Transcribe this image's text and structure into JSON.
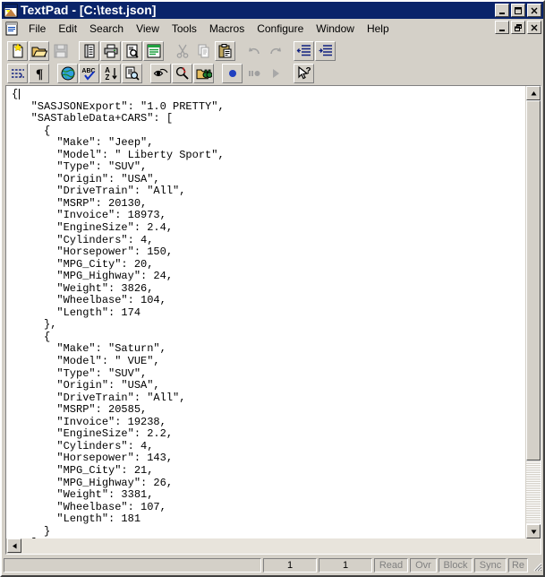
{
  "window": {
    "title": "TextPad - [C:\\test.json]",
    "app_icon": "textpad-icon",
    "controls": [
      {
        "name": "minimize-button",
        "glyph": "minimize-icon"
      },
      {
        "name": "maximize-button",
        "glyph": "maximize-icon"
      },
      {
        "name": "close-button",
        "glyph": "close-icon"
      }
    ],
    "mdi_controls": [
      {
        "name": "mdi-minimize-button",
        "glyph": "minimize-icon"
      },
      {
        "name": "mdi-restore-button",
        "glyph": "restore-icon"
      },
      {
        "name": "mdi-close-button",
        "glyph": "close-icon"
      }
    ]
  },
  "menu": {
    "document_icon": "document-icon",
    "items": [
      {
        "label": "File"
      },
      {
        "label": "Edit"
      },
      {
        "label": "Search"
      },
      {
        "label": "View"
      },
      {
        "label": "Tools"
      },
      {
        "label": "Macros"
      },
      {
        "label": "Configure"
      },
      {
        "label": "Window"
      },
      {
        "label": "Help"
      }
    ]
  },
  "toolbar_row1": [
    {
      "name": "new-file-button",
      "icon": "new-document-icon",
      "enabled": true
    },
    {
      "name": "open-file-button",
      "icon": "open-folder-icon",
      "enabled": true
    },
    {
      "name": "save-file-button",
      "icon": "floppy-disk-icon",
      "enabled": false
    },
    {
      "sep": true
    },
    {
      "name": "document-properties-button",
      "icon": "document-lines-icon",
      "enabled": true
    },
    {
      "name": "print-button",
      "icon": "printer-icon",
      "enabled": true
    },
    {
      "name": "print-preview-button",
      "icon": "magnifier-page-icon",
      "enabled": true
    },
    {
      "name": "document-selector-button",
      "icon": "green-document-icon",
      "enabled": true
    },
    {
      "sep": true
    },
    {
      "name": "cut-button",
      "icon": "scissors-icon",
      "enabled": false
    },
    {
      "name": "copy-button",
      "icon": "copy-pages-icon",
      "enabled": false
    },
    {
      "name": "paste-button",
      "icon": "clipboard-icon",
      "enabled": true
    },
    {
      "sep": true
    },
    {
      "name": "undo-button",
      "icon": "undo-arrow-icon",
      "enabled": false
    },
    {
      "name": "redo-button",
      "icon": "redo-arrow-icon",
      "enabled": false
    },
    {
      "sep": true
    },
    {
      "name": "decrease-indent-button",
      "icon": "outdent-icon",
      "enabled": true
    },
    {
      "name": "increase-indent-button",
      "icon": "indent-icon",
      "enabled": true
    }
  ],
  "toolbar_row2": [
    {
      "name": "word-wrap-button",
      "icon": "word-wrap-icon",
      "enabled": true
    },
    {
      "name": "show-paragraphs-button",
      "icon": "pilcrow-icon",
      "enabled": true
    },
    {
      "sep": true
    },
    {
      "name": "web-browser-button",
      "icon": "globe-icon",
      "enabled": true
    },
    {
      "name": "spell-check-button",
      "icon": "spell-check-icon",
      "enabled": true
    },
    {
      "name": "sort-button",
      "icon": "sort-az-icon",
      "enabled": true
    },
    {
      "name": "compare-files-button",
      "icon": "compare-files-icon",
      "enabled": true
    },
    {
      "sep": true
    },
    {
      "name": "find-button",
      "icon": "find-eye-icon",
      "enabled": true
    },
    {
      "name": "replace-button",
      "icon": "replace-magnifier-icon",
      "enabled": true
    },
    {
      "name": "find-in-files-button",
      "icon": "binoculars-folder-icon",
      "enabled": true
    },
    {
      "sep": true
    },
    {
      "name": "record-macro-button",
      "icon": "record-dot-icon",
      "enabled": true
    },
    {
      "name": "pause-macro-button",
      "icon": "pause-icon",
      "enabled": false
    },
    {
      "name": "play-macro-button",
      "icon": "play-icon",
      "enabled": false
    },
    {
      "sep": true
    },
    {
      "name": "context-help-button",
      "icon": "arrow-question-icon",
      "enabled": true
    }
  ],
  "editor": {
    "content": "{\n   \"SASJSONExport\": \"1.0 PRETTY\",\n   \"SASTableData+CARS\": [\n     {\n       \"Make\": \"Jeep\",\n       \"Model\": \" Liberty Sport\",\n       \"Type\": \"SUV\",\n       \"Origin\": \"USA\",\n       \"DriveTrain\": \"All\",\n       \"MSRP\": 20130,\n       \"Invoice\": 18973,\n       \"EngineSize\": 2.4,\n       \"Cylinders\": 4,\n       \"Horsepower\": 150,\n       \"MPG_City\": 20,\n       \"MPG_Highway\": 24,\n       \"Weight\": 3826,\n       \"Wheelbase\": 104,\n       \"Length\": 174\n     },\n     {\n       \"Make\": \"Saturn\",\n       \"Model\": \" VUE\",\n       \"Type\": \"SUV\",\n       \"Origin\": \"USA\",\n       \"DriveTrain\": \"All\",\n       \"MSRP\": 20585,\n       \"Invoice\": 19238,\n       \"EngineSize\": 2.2,\n       \"Cylinders\": 4,\n       \"Horsepower\": 143,\n       \"MPG_City\": 21,\n       \"MPG_Highway\": 26,\n       \"Weight\": 3381,\n       \"Wheelbase\": 107,\n       \"Length\": 181\n     }\n   ]\n }"
  },
  "statusbar": {
    "message": "",
    "line": "1",
    "column": "1",
    "flags": [
      {
        "name": "read-only-flag",
        "label": "Read"
      },
      {
        "name": "overwrite-flag",
        "label": "Ovr"
      },
      {
        "name": "block-select-flag",
        "label": "Block"
      },
      {
        "name": "sync-scroll-flag",
        "label": "Sync"
      },
      {
        "name": "recording-flag",
        "label": "Re"
      }
    ]
  },
  "colors": {
    "title_bar": "#0a246a",
    "face": "#d4d0c8",
    "editor_bg": "#ffffff",
    "text": "#000000",
    "disabled_text": "#808080"
  }
}
